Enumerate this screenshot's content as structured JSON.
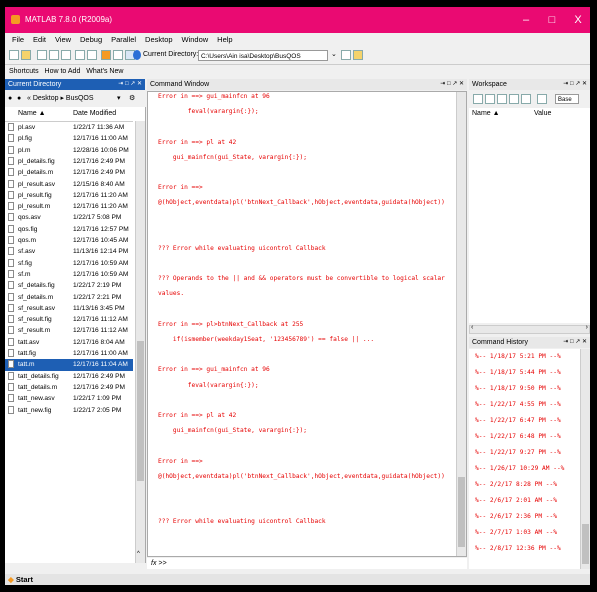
{
  "window": {
    "title": "MATLAB 7.8.0 (R2009a)",
    "min": "–",
    "max": "□",
    "close": "X"
  },
  "menu": [
    "File",
    "Edit",
    "View",
    "Debug",
    "Parallel",
    "Desktop",
    "Window",
    "Help"
  ],
  "toolbar": {
    "current_dir_label": "Current Directory:",
    "current_dir_value": "C:\\Users\\Ain isa\\Desktop\\BusQOS"
  },
  "shortcuts": {
    "label": "Shortcuts",
    "how_to_add": "How to Add",
    "whats_new": "What's New"
  },
  "current_directory": {
    "title": "Current Directory",
    "breadcrumb": "« Desktop ▸ BusQOS",
    "col_name": "Name ▲",
    "col_date": "Date Modified",
    "files": [
      {
        "name": "pl.asv",
        "date": "1/22/17 11:36 AM"
      },
      {
        "name": "pl.fig",
        "date": "12/17/16 11:00 AM"
      },
      {
        "name": "pl.m",
        "date": "12/28/16 10:06 PM"
      },
      {
        "name": "pl_details.fig",
        "date": "12/17/16 2:49 PM"
      },
      {
        "name": "pl_details.m",
        "date": "12/17/16 2:49 PM"
      },
      {
        "name": "pl_result.asv",
        "date": "12/15/16 8:40 AM"
      },
      {
        "name": "pl_result.fig",
        "date": "12/17/16 11:20 AM"
      },
      {
        "name": "pl_result.m",
        "date": "12/17/16 11:20 AM"
      },
      {
        "name": "qos.asv",
        "date": "1/22/17 5:08 PM"
      },
      {
        "name": "qos.fig",
        "date": "12/17/16 12:57 PM"
      },
      {
        "name": "qos.m",
        "date": "12/17/16 10:45 AM"
      },
      {
        "name": "sf.asv",
        "date": "11/13/16 12:14 PM"
      },
      {
        "name": "sf.fig",
        "date": "12/17/16 10:59 AM"
      },
      {
        "name": "sf.m",
        "date": "12/17/16 10:59 AM"
      },
      {
        "name": "sf_details.fig",
        "date": "1/22/17 2:19 PM"
      },
      {
        "name": "sf_details.m",
        "date": "1/22/17 2:21 PM"
      },
      {
        "name": "sf_result.asv",
        "date": "11/13/16 3:45 PM"
      },
      {
        "name": "sf_result.fig",
        "date": "12/17/16 11:12 AM"
      },
      {
        "name": "sf_result.m",
        "date": "12/17/16 11:12 AM"
      },
      {
        "name": "tatt.asv",
        "date": "12/17/16 8:04 AM"
      },
      {
        "name": "tatt.fig",
        "date": "12/17/16 11:00 AM"
      },
      {
        "name": "tatt.m",
        "date": "12/17/16 11:04 AM"
      },
      {
        "name": "tatt_details.fig",
        "date": "12/17/16 2:49 PM"
      },
      {
        "name": "tatt_details.m",
        "date": "12/17/16 2:49 PM"
      },
      {
        "name": "tatt_new.asv",
        "date": "1/22/17 1:09 PM"
      },
      {
        "name": "tatt_new.fig",
        "date": "1/22/17 2:05 PM"
      }
    ],
    "selected_index": 21
  },
  "command_window": {
    "title": "Command Window",
    "lines": [
      "Error in ==> gui_mainfcn at 96",
      "        feval(varargin{:});",
      "",
      "Error in ==> pl at 42",
      "    gui_mainfcn(gui_State, varargin{:});",
      "",
      "Error in ==>",
      "@(hObject,eventdata)pl('btnNext_Callback',hObject,eventdata,guidata(hObject))",
      "",
      "",
      "??? Error while evaluating uicontrol Callback",
      "",
      "??? Operands to the || and && operators must be convertible to logical scalar",
      "values.",
      "",
      "Error in ==> pl>btnNext_Callback at 255",
      "    if(ismember(weekday1Seat, '123456789') == false || ...",
      "",
      "Error in ==> gui_mainfcn at 96",
      "        feval(varargin{:});",
      "",
      "Error in ==> pl at 42",
      "    gui_mainfcn(gui_State, varargin{:});",
      "",
      "Error in ==>",
      "@(hObject,eventdata)pl('btnNext_Callback',hObject,eventdata,guidata(hObject))",
      "",
      "",
      "??? Error while evaluating uicontrol Callback"
    ],
    "prompt": "fx >>"
  },
  "workspace": {
    "title": "Workspace",
    "base": "Base",
    "col_name": "Name ▲",
    "col_value": "Value"
  },
  "command_history": {
    "title": "Command History",
    "entries": [
      "%-- 1/18/17  5:21 PM --%",
      "%-- 1/18/17  5:44 PM --%",
      "%-- 1/18/17  9:50 PM --%",
      "%-- 1/22/17  4:55 PM --%",
      "%-- 1/22/17  6:47 PM --%",
      "%-- 1/22/17  6:48 PM --%",
      "%-- 1/22/17  9:27 PM --%",
      "%-- 1/26/17 10:29 AM --%",
      "%-- 2/2/17  8:28 PM --%",
      "%-- 2/6/17  2:01 AM --%",
      "%-- 2/6/17  2:36 PM --%",
      "%-- 2/7/17  1:03 AM --%",
      "%-- 2/8/17 12:36 PM --%"
    ]
  },
  "status": {
    "start": "Start"
  },
  "colors": {
    "titlebar": "#ea0a72",
    "selection": "#1e5fb4",
    "error_text": "#e60000"
  }
}
